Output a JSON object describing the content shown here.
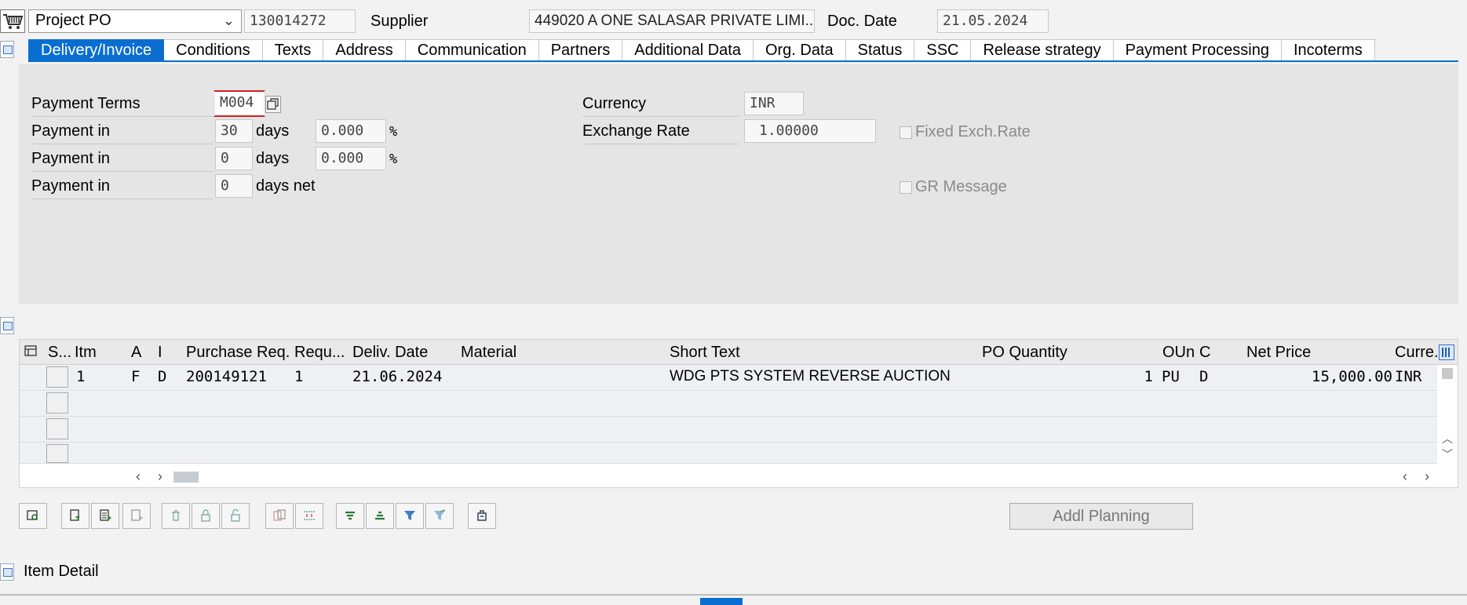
{
  "header": {
    "doc_type": "Project PO",
    "po_number": "130014272",
    "supplier_label": "Supplier",
    "supplier_value": "449020 A ONE SALASAR PRIVATE LIMI...",
    "doc_date_label": "Doc. Date",
    "doc_date_value": "21.05.2024"
  },
  "tabs": [
    {
      "label": "Delivery/Invoice",
      "active": true
    },
    {
      "label": "Conditions"
    },
    {
      "label": "Texts"
    },
    {
      "label": "Address"
    },
    {
      "label": "Communication"
    },
    {
      "label": "Partners"
    },
    {
      "label": "Additional Data"
    },
    {
      "label": "Org. Data"
    },
    {
      "label": "Status"
    },
    {
      "label": "SSC"
    },
    {
      "label": "Release strategy"
    },
    {
      "label": "Payment Processing"
    },
    {
      "label": "Incoterms"
    }
  ],
  "delivery": {
    "payment_terms_label": "Payment Terms",
    "payment_terms_value": "M004",
    "rows": [
      {
        "label": "Payment in",
        "days": "30",
        "unit": "days",
        "pct": "0.000",
        "pct_sign": "%"
      },
      {
        "label": "Payment in",
        "days": "0",
        "unit": "days",
        "pct": "0.000",
        "pct_sign": "%"
      },
      {
        "label": "Payment in",
        "days": "0",
        "unit": "days net"
      }
    ],
    "currency_label": "Currency",
    "currency_value": "INR",
    "exrate_label": "Exchange Rate",
    "exrate_value": "1.00000",
    "fixed_exch_label": "Fixed Exch.Rate",
    "gr_message_label": "GR Message"
  },
  "items_table": {
    "columns": [
      "S...",
      "Itm",
      "A",
      "I",
      "Purchase Req.",
      "Requ...",
      "Deliv. Date",
      "Material",
      "Short Text",
      "PO Quantity",
      "OUn",
      "C",
      "Net Price",
      "Curre..."
    ],
    "rows": [
      {
        "itm": "1",
        "a": "F",
        "i": "D",
        "pr": "200149121",
        "req": "1",
        "deliv": "21.06.2024",
        "material": "",
        "short_text": "WDG PTS SYSTEM REVERSE AUCTION",
        "qty": "1",
        "oun": "PU",
        "c": "D",
        "net_price": "15,000.00",
        "curr": "INR"
      }
    ]
  },
  "buttons": {
    "addl_planning": "Addl Planning"
  },
  "item_detail_label": "Item Detail",
  "colors": {
    "accent": "#0a6ed1",
    "panel": "#e5e5e5",
    "background": "#f2f2f2"
  }
}
